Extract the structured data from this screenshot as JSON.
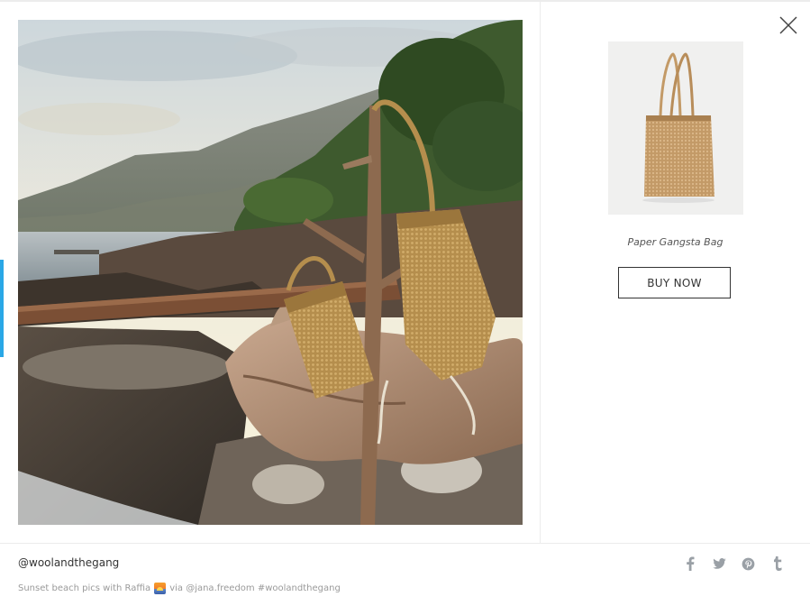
{
  "photo": {
    "alt_icon": "photo-image"
  },
  "product": {
    "name": "Paper Gangsta Bag",
    "buy_label": "BUY NOW"
  },
  "footer": {
    "username": "@woolandthegang",
    "caption_before": "Sunset beach pics with Raffia",
    "caption_emoji": "sunset-emoji",
    "caption_after": "via @jana.freedom #woolandthegang"
  },
  "share": {
    "icons": [
      "facebook-icon",
      "twitter-icon",
      "pinterest-icon",
      "tumblr-icon"
    ],
    "icon_color": "#9aa0a6"
  },
  "colors": {
    "accent": "#2aa7e6",
    "text": "#333333",
    "muted": "#9a9a9a",
    "divider": "#ececec"
  }
}
